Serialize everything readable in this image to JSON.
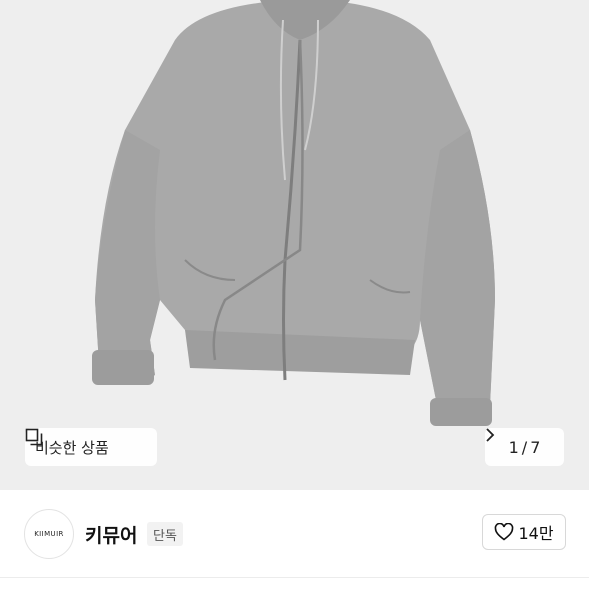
{
  "gallery": {
    "product_image_alt": "grey zip-up hoodie",
    "similar_button_label": "비슷한 상품",
    "current_index": "1",
    "separator": "/",
    "total": "7",
    "next_icon": "chevron-right-icon"
  },
  "seller": {
    "logo_text": "KIIMUIR",
    "brand_name": "키뮤어",
    "badge": "단독",
    "like_count": "14만",
    "like_icon": "heart-outline-icon"
  },
  "colors": {
    "hoodie": "#a9a9a9",
    "gallery_bg": "#eeeeee"
  }
}
